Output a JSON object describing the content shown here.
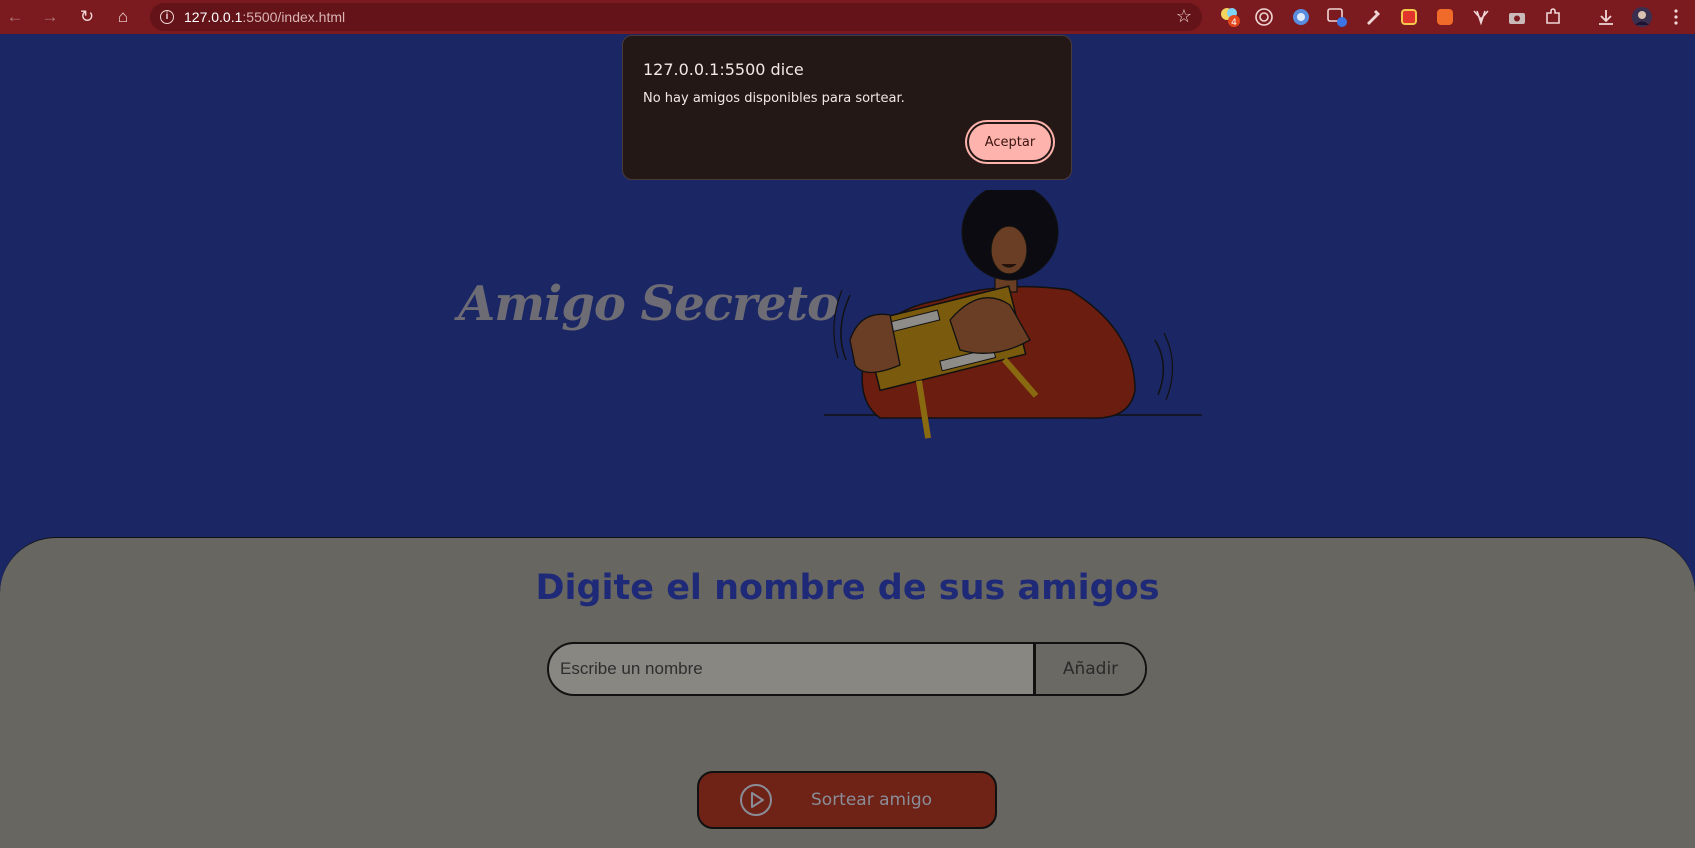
{
  "browser": {
    "url_host": "127.0.0.1",
    "url_path": ":5500/index.html",
    "extension_badge": "4"
  },
  "page": {
    "hero_title": "Amigo Secreto",
    "section_title": "Digite el nombre de sus amigos",
    "input_placeholder": "Escribe un nombre",
    "add_button": "Añadir",
    "draw_button": "Sortear amigo"
  },
  "dialog": {
    "title": "127.0.0.1:5500 dice",
    "message": "No hay amigos disponibles para sortear.",
    "ok_button": "Aceptar"
  },
  "colors": {
    "toolbar": "#7b1b1f",
    "page_background": "#1b2665",
    "section_background": "#686660",
    "title_blue": "#1e2a77",
    "draw_button": "#6e2316",
    "dialog_button": "#ffb3ad"
  },
  "icons": {
    "back": "arrow-left-icon",
    "forward": "arrow-right-icon",
    "reload": "reload-icon",
    "home": "home-icon",
    "site_info": "info-icon",
    "bookmark": "star-icon",
    "downloads": "download-icon",
    "menu": "kebab-menu-icon",
    "draw": "play-circle-icon"
  }
}
